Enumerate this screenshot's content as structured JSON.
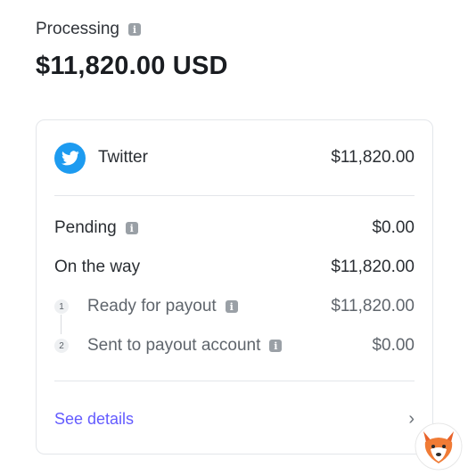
{
  "header": {
    "label": "Processing",
    "total": "$11,820.00 USD"
  },
  "source": {
    "name": "Twitter",
    "amount": "$11,820.00"
  },
  "breakdown": {
    "pending": {
      "label": "Pending",
      "amount": "$0.00"
    },
    "on_the_way": {
      "label": "On the way",
      "amount": "$11,820.00"
    },
    "steps": [
      {
        "number": "1",
        "label": "Ready for payout",
        "amount": "$11,820.00"
      },
      {
        "number": "2",
        "label": "Sent to payout account",
        "amount": "$0.00"
      }
    ]
  },
  "footer": {
    "link_label": "See details",
    "chevron": "›"
  },
  "icons": {
    "info": "i",
    "source": "twitter-icon",
    "watermark": "fox-logo"
  },
  "colors": {
    "link": "#635bff",
    "twitter": "#1d9bf0"
  }
}
